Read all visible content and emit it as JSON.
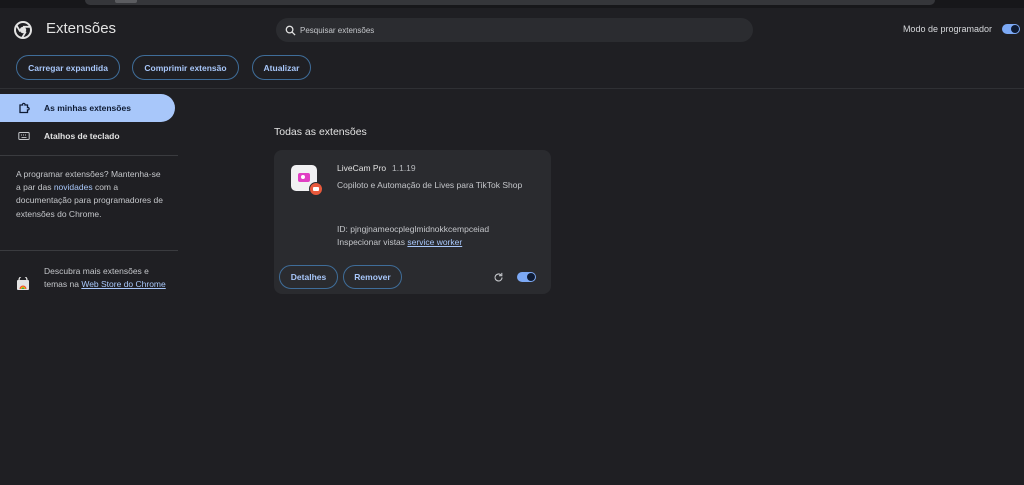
{
  "header": {
    "title": "Extensões",
    "search_placeholder": "Pesquisar extensões",
    "dev_mode_label": "Modo de programador",
    "dev_mode_on": true
  },
  "toolbar": {
    "load_unpacked": "Carregar expandida",
    "pack_extension": "Comprimir extensão",
    "update": "Atualizar"
  },
  "sidebar": {
    "items": [
      {
        "label": "As minhas extensões",
        "active": true,
        "icon": "puzzle-icon"
      },
      {
        "label": "Atalhos de teclado",
        "active": false,
        "icon": "keyboard-icon"
      }
    ],
    "dev_text_1": "A programar extensões? Mantenha-se a par das ",
    "dev_link": "novidades",
    "dev_text_2": " com a documentação para programadores de extensões do Chrome.",
    "store_text": "Descubra mais extensões e temas na ",
    "store_link": "Web Store do Chrome"
  },
  "main": {
    "section_title": "Todas as extensões",
    "extension": {
      "name": "LiveCam Pro",
      "version": "1.1.19",
      "description": "Copiloto e Automação de Lives para TikTok Shop",
      "id_line": "ID: pjngjnameocpleglmidnokkcempceiad",
      "inspect_text": "Inspecionar vistas ",
      "inspect_link": "service worker",
      "details_label": "Detalhes",
      "remove_label": "Remover",
      "enabled": true
    }
  },
  "colors": {
    "background": "#1f1f23",
    "accent": "#a8c7fa",
    "card": "#2a2b2f"
  }
}
